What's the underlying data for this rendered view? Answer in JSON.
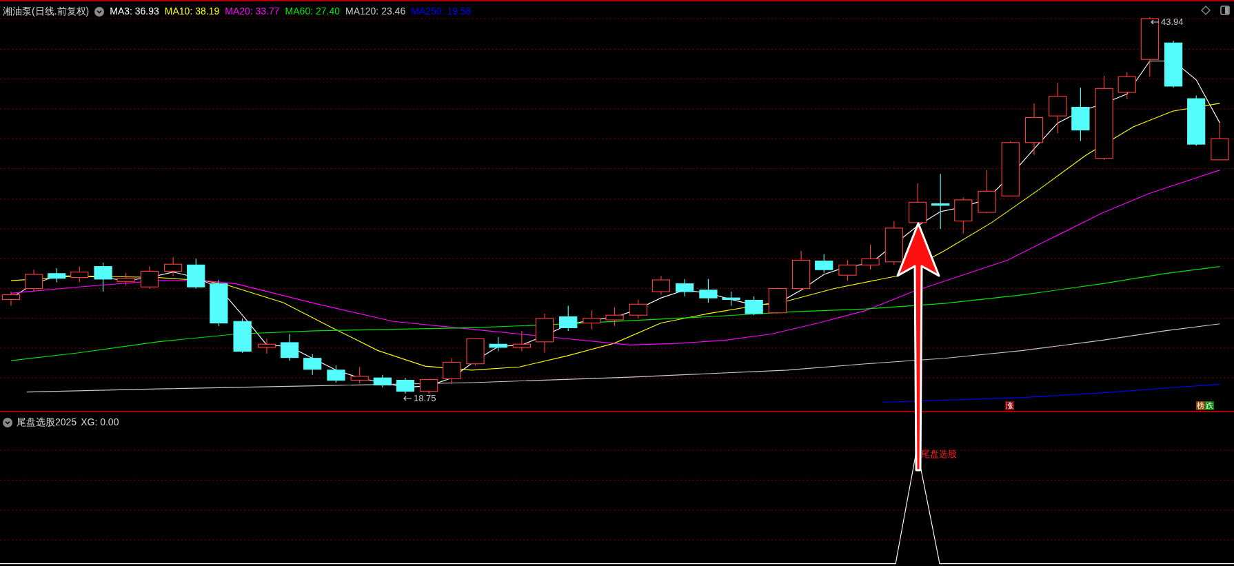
{
  "chart_title": "湘油泵(日线.前复权)",
  "moving_averages": [
    {
      "label": "MA3: 36.93",
      "color": "#ffffff"
    },
    {
      "label": "MA10: 38.19",
      "color": "#ffff00"
    },
    {
      "label": "MA20: 33.77",
      "color": "#ff00ff"
    },
    {
      "label": "MA60: 27.40",
      "color": "#00e600"
    },
    {
      "label": "MA120: 23.46",
      "color": "#c8c8c8"
    },
    {
      "label": "MA250: 19.58",
      "color": "#0000ff"
    }
  ],
  "price_labels": [
    {
      "kind": "high",
      "text": "43.94"
    },
    {
      "kind": "low",
      "text": "18.75"
    }
  ],
  "markers": [
    {
      "badges": [
        {
          "text": "涨",
          "color": "#8b0000"
        }
      ]
    },
    {
      "badges": [
        {
          "text": "榜",
          "color": "#8b4500"
        },
        {
          "text": "跌",
          "color": "#008000"
        }
      ]
    }
  ],
  "indicator": {
    "title": "尾盘选股2025",
    "value_label": "XG: 0.00",
    "signal_label": "尾盘选股"
  }
}
